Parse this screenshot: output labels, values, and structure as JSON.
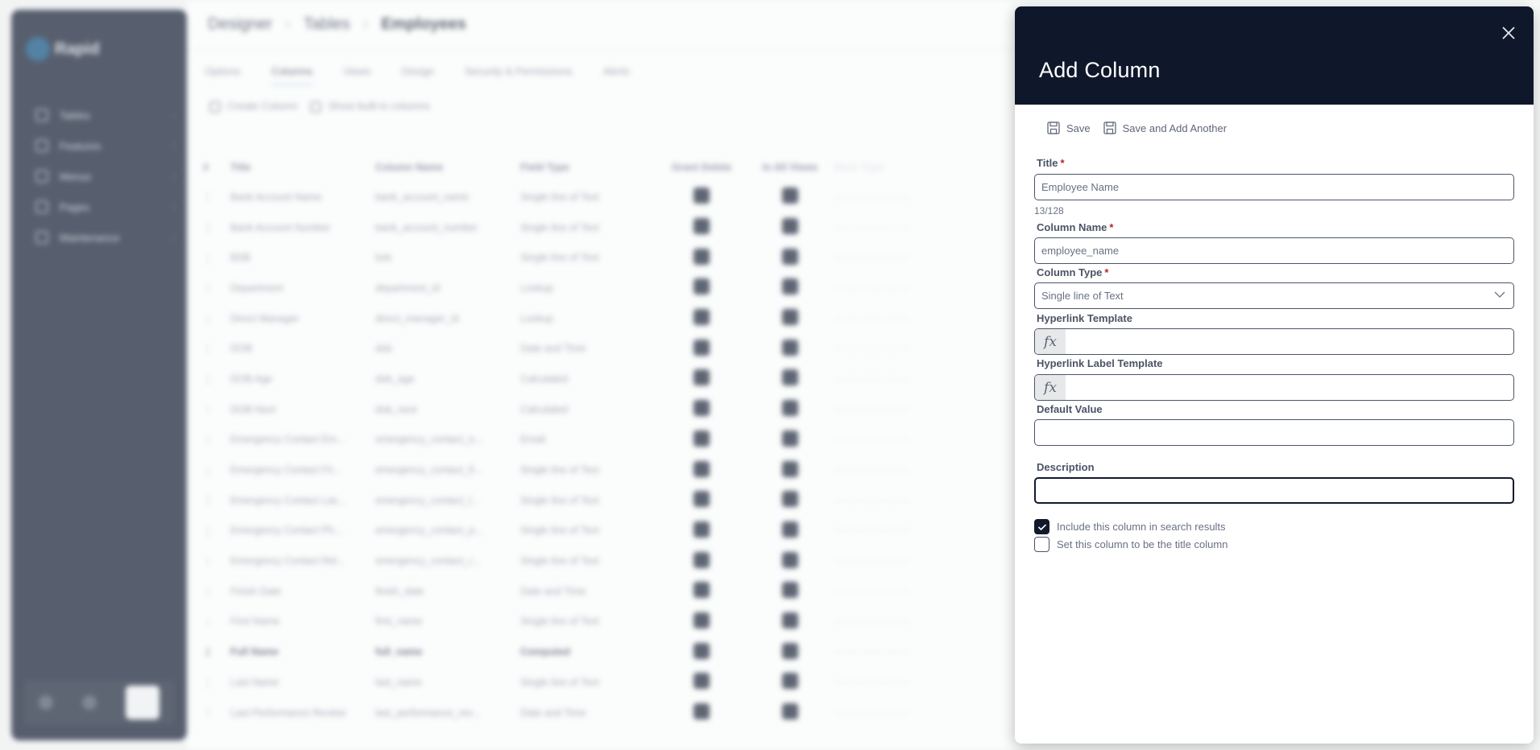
{
  "background": {
    "app_name": "Rapid",
    "sidebar": {
      "items": [
        {
          "label": "Tables",
          "icon": "table-icon"
        },
        {
          "label": "Features",
          "icon": "features-icon"
        },
        {
          "label": "Menus",
          "icon": "menu-icon"
        },
        {
          "label": "Pages",
          "icon": "page-icon"
        },
        {
          "label": "Maintenance",
          "icon": "maintenance-icon"
        }
      ]
    },
    "breadcrumb": [
      "Designer",
      "Tables",
      "Employees"
    ],
    "tabs": [
      {
        "label": "Options",
        "active": false
      },
      {
        "label": "Columns",
        "active": true
      },
      {
        "label": "Views",
        "active": false
      },
      {
        "label": "Design",
        "active": false
      },
      {
        "label": "Security & Permissions",
        "active": false
      },
      {
        "label": "Alerts",
        "active": false
      }
    ],
    "actions": {
      "create_column": "Create Column",
      "show_built_in": "Show built-in columns"
    },
    "table": {
      "headers": [
        "#",
        "Title",
        "Column Name",
        "Field Type",
        "Grant Delete",
        "In All Views",
        "Base Type"
      ],
      "rows": [
        [
          "Bank Account Name",
          "bank_account_name",
          "Single line of Text"
        ],
        [
          "Bank Account Number",
          "bank_account_number",
          "Single line of Text"
        ],
        [
          "BSB",
          "bsb",
          "Single line of Text"
        ],
        [
          "Department",
          "department_id",
          "Lookup"
        ],
        [
          "Direct Manager",
          "direct_manager_id",
          "Lookup"
        ],
        [
          "DOB",
          "dob",
          "Date and Time"
        ],
        [
          "DOB Age",
          "dob_age",
          "Calculated"
        ],
        [
          "DOB Next",
          "dob_next",
          "Calculated"
        ],
        [
          "Emergency Contact Em...",
          "emergency_contact_e...",
          "Email"
        ],
        [
          "Emergency Contact Fir...",
          "emergency_contact_fi...",
          "Single line of Text"
        ],
        [
          "Emergency Contact Las...",
          "emergency_contact_l...",
          "Single line of Text"
        ],
        [
          "Emergency Contact Ph...",
          "emergency_contact_p...",
          "Single line of Text"
        ],
        [
          "Emergency Contact Rel...",
          "emergency_contact_r...",
          "Single line of Text"
        ],
        [
          "Finish Date",
          "finish_date",
          "Date and Time"
        ],
        [
          "First Name",
          "first_name",
          "Single line of Text"
        ],
        [
          "Full Name",
          "full_name",
          "Computed"
        ],
        [
          "Last Name",
          "last_name",
          "Single line of Text"
        ],
        [
          "Last Performance Review",
          "last_performance_rev...",
          "Date and Time"
        ]
      ],
      "bold_row_index": 15
    }
  },
  "panel": {
    "title": "Add Column",
    "close_icon": "close-icon",
    "toolbar": {
      "save_label": "Save",
      "save_add_label": "Save and Add Another"
    },
    "fields": {
      "title": {
        "label": "Title",
        "required_mark": "*",
        "value": "Employee Name",
        "counter": "13/128"
      },
      "column_name": {
        "label": "Column Name",
        "required_mark": "*",
        "value": "employee_name"
      },
      "column_type": {
        "label": "Column Type",
        "required_mark": "*",
        "value": "Single line of Text"
      },
      "hyperlink_template": {
        "label": "Hyperlink Template",
        "prefix": "fx",
        "value": ""
      },
      "hyperlink_label_template": {
        "label": "Hyperlink Label Template",
        "prefix": "fx",
        "value": ""
      },
      "default_value": {
        "label": "Default Value",
        "value": ""
      },
      "description": {
        "label": "Description",
        "value": ""
      }
    },
    "checkboxes": [
      {
        "label": "Include this column in search results",
        "checked": true
      },
      {
        "label": "Set this column to be the title column",
        "checked": false
      }
    ]
  },
  "colors": {
    "panel_header": "#0f182b",
    "sidebar": "#252e42",
    "required": "#b3262d",
    "checkbox_checked": "#111a2c"
  }
}
